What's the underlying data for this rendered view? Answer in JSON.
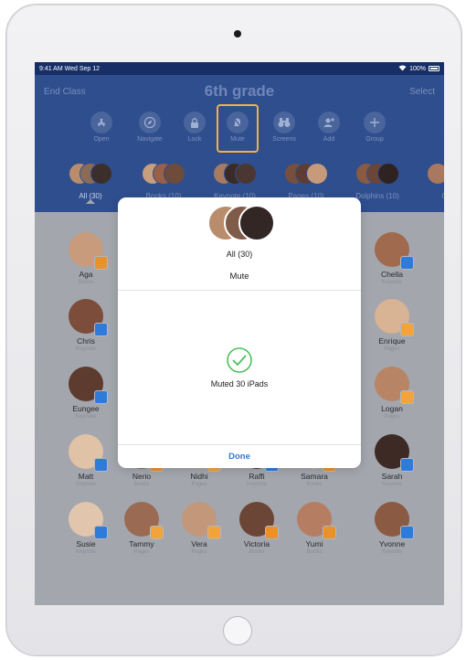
{
  "status_bar": {
    "time": "9:41 AM",
    "date": "Wed Sep 12",
    "battery": "100%"
  },
  "nav": {
    "left": "End Class",
    "title": "6th grade",
    "right": "Select"
  },
  "toolbar": [
    {
      "label": "Open",
      "icon": "appstore-icon"
    },
    {
      "label": "Navigate",
      "icon": "compass-icon"
    },
    {
      "label": "Lock",
      "icon": "lock-icon"
    },
    {
      "label": "Mute",
      "icon": "bell-slash-icon"
    },
    {
      "label": "Screens",
      "icon": "binoculars-icon"
    },
    {
      "label": "Add",
      "icon": "add-person-icon"
    },
    {
      "label": "Group",
      "icon": "plus-icon"
    }
  ],
  "groups": [
    {
      "label": "All (30)"
    },
    {
      "label": "Books (10)"
    },
    {
      "label": "Keynote (10)"
    },
    {
      "label": "Pages (10)"
    },
    {
      "label": "Dolphins (10)"
    },
    {
      "label": "Otte"
    }
  ],
  "students": [
    {
      "name": "Aga",
      "app": "Books"
    },
    {
      "name": "Chella",
      "app": "Keynote"
    },
    {
      "name": "Chris",
      "app": "Keynote"
    },
    {
      "name": "Enrique",
      "app": "Pages"
    },
    {
      "name": "Eungee",
      "app": "Keynote"
    },
    {
      "name": "Logan",
      "app": "Pages"
    },
    {
      "name": "Matt",
      "app": "Keynote"
    },
    {
      "name": "Nerio",
      "app": "Books"
    },
    {
      "name": "Nidhi",
      "app": "Pages"
    },
    {
      "name": "Raffi",
      "app": "Keynote"
    },
    {
      "name": "Samara",
      "app": "Books"
    },
    {
      "name": "Sarah",
      "app": "Keynote"
    },
    {
      "name": "Susie",
      "app": "Keynote"
    },
    {
      "name": "Tammy",
      "app": "Pages"
    },
    {
      "name": "Vera",
      "app": "Pages"
    },
    {
      "name": "Victoria",
      "app": "Books"
    },
    {
      "name": "Yumi",
      "app": "Books"
    },
    {
      "name": "Yvonne",
      "app": "Keynote"
    }
  ],
  "modal": {
    "group": "All (30)",
    "action": "Mute",
    "status": "Muted 30 iPads",
    "done_label": "Done"
  },
  "colors": {
    "header": "#2f4e8e",
    "accent": "#3478d6",
    "highlight": "#f0b341",
    "success": "#4cc05a",
    "books": "#e9912b",
    "keynote": "#2f7bd8",
    "pages": "#f2a33a"
  }
}
